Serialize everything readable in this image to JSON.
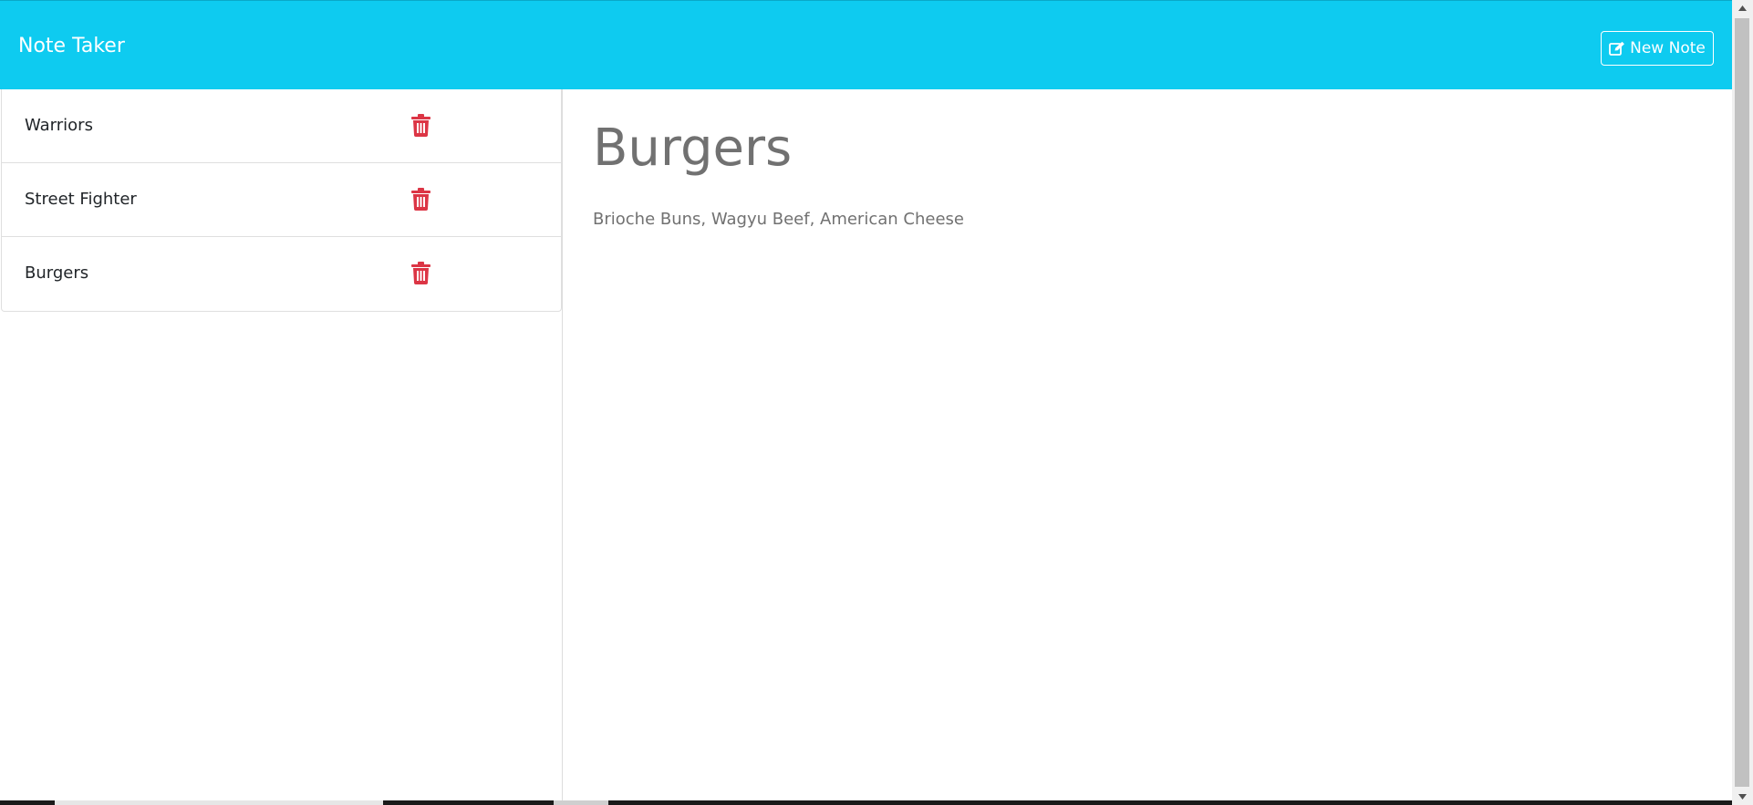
{
  "app": {
    "title": "Note Taker"
  },
  "toolbar": {
    "new_note_label": "New Note",
    "new_note_icon": "edit-icon"
  },
  "sidebar": {
    "notes": [
      {
        "title": "Warriors",
        "delete_icon": "trash-icon"
      },
      {
        "title": "Street Fighter",
        "delete_icon": "trash-icon"
      },
      {
        "title": "Burgers",
        "delete_icon": "trash-icon"
      }
    ]
  },
  "main": {
    "note_title": "Burgers",
    "note_text": "Brioche Buns, Wagyu Beef, American Cheese"
  },
  "colors": {
    "navbar": "#0ecbf0",
    "delete": "#dc3545",
    "muted_text": "#717171"
  }
}
